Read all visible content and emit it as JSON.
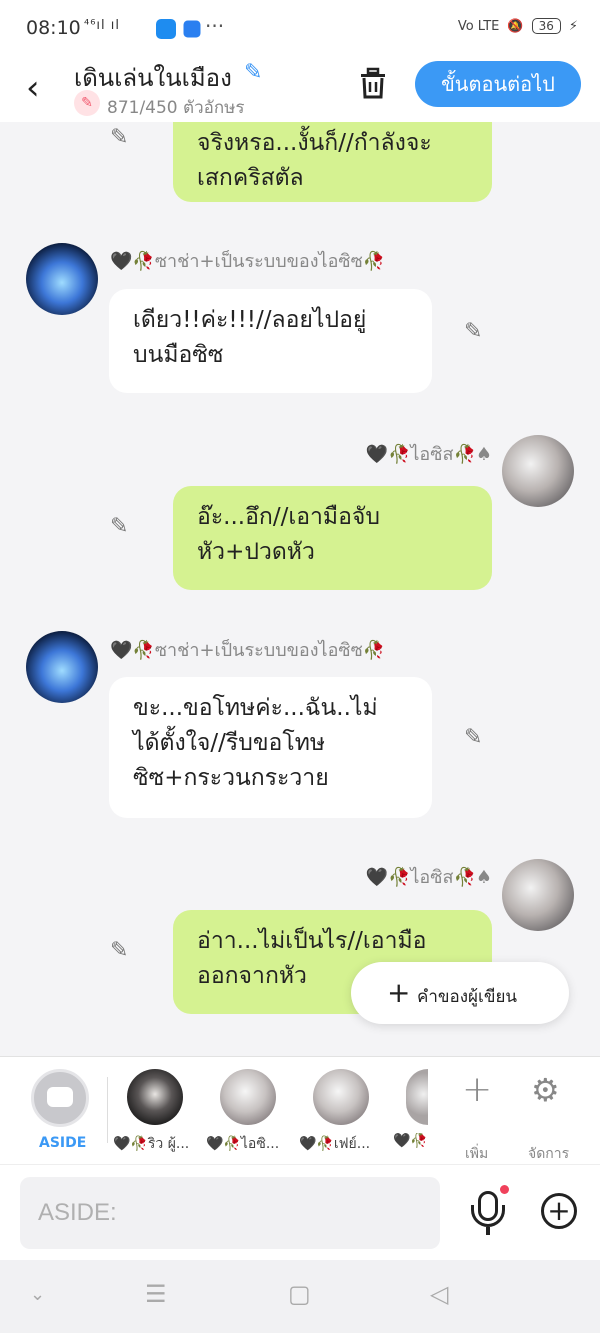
{
  "status_bar": {
    "time": "08:10",
    "signal": "⁴⁶ıl ıl",
    "more": "···",
    "volte": "Vo LTE",
    "battery": "36"
  },
  "header": {
    "back": "‹",
    "title": "เดินเล่นในเมือง",
    "counter": "871/450 ตัวอักษร",
    "next_button": "ขั้นตอนต่อไป"
  },
  "messages": [
    {
      "side": "right",
      "text_lines": [
        "จริงหรอ...งั้นก็//กำลังจะ",
        "เสกคริสตัล"
      ]
    },
    {
      "side": "left",
      "sender": "🖤🥀ซาช่า+เป็นระบบของไอซิซ🥀",
      "text_lines": [
        "เดียว!!ค่ะ!!!//ลอยไปอยู่",
        "บนมือซิซ"
      ]
    },
    {
      "side": "right",
      "sender": "🖤🥀ไอซิส🥀♠",
      "text_lines": [
        "อ๊ะ...อึก//เอามือจับ",
        "หัว+ปวดหัว"
      ]
    },
    {
      "side": "left",
      "sender": "🖤🥀ซาช่า+เป็นระบบของไอซิซ🥀",
      "text_lines": [
        "ขะ...ขอโทษค่ะ...ฉัน..ไม่",
        "ได้ตั้งใจ//รีบขอโทษ",
        "ซิซ+กระวนกระวาย"
      ]
    },
    {
      "side": "right",
      "sender": "🖤🥀ไอซิส🥀♠",
      "text_lines": [
        "อ่าา...ไม่เป็นไร//เอามือ",
        "ออกจากหัว"
      ]
    }
  ],
  "fab": {
    "label": "คำของผู้เขียน"
  },
  "character_bar": {
    "aside_label": "ASIDE",
    "characters": [
      {
        "name": "🖤🥀ริว ผู้..."
      },
      {
        "name": "🖤🥀ไอซิ..."
      },
      {
        "name": "🖤🥀เฟย์..."
      },
      {
        "name": "🖤🥀"
      }
    ],
    "add_label": "เพิ่ม",
    "manage_label": "จัดการ"
  },
  "input": {
    "placeholder": "ASIDE:"
  }
}
